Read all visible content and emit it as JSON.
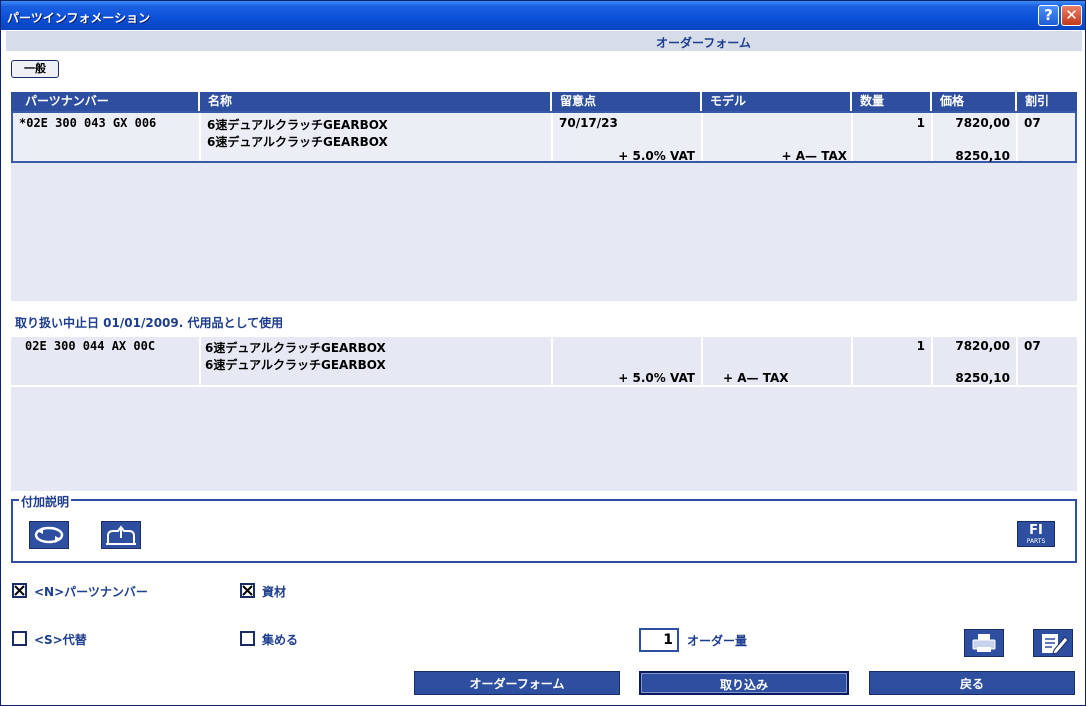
{
  "window": {
    "title": "パーツインフォメーション",
    "help_glyph": "?",
    "close_glyph": "✕"
  },
  "subheader": {
    "title": "オーダーフォーム"
  },
  "tabs": [
    {
      "label": "一般"
    }
  ],
  "table": {
    "columns": [
      "パーツナンバー",
      "名称",
      "留意点",
      "モデル",
      "数量",
      "価格",
      "割引"
    ],
    "rows": [
      {
        "part_no": "*02E 300 043 GX 006",
        "name1": "6速デュアルクラッチGEARBOX",
        "name2": "6速デュアルクラッチGEARBOX",
        "note": "70/17/23",
        "vat": "+ 5.0% VAT",
        "tax": "+  A— TAX",
        "qty": "1",
        "price": "7820,00",
        "price_tax": "8250,10",
        "discount": "07"
      }
    ]
  },
  "discontinued_note": "取り扱い中止日 01/01/2009. 代用品として使用",
  "substitute_table": {
    "rows": [
      {
        "part_no": "02E 300 044 AX 00C",
        "name1": "6速デュアルクラッチGEARBOX",
        "name2": "6速デュアルクラッチGEARBOX",
        "note": "",
        "vat": "+ 5.0% VAT",
        "tax": "+  A— TAX",
        "qty": "1",
        "price": "7820,00",
        "price_tax": "8250,10",
        "discount": "07"
      }
    ]
  },
  "additional_info": {
    "legend": "付加説明",
    "icons": [
      "refresh-icon",
      "crown-icon",
      "fi-parts-logo"
    ],
    "logo_text": "FI",
    "logo_subtext": "PARTS"
  },
  "checkboxes": [
    {
      "label": "<N>パーツナンバー",
      "checked": true
    },
    {
      "label": "資材",
      "checked": true
    },
    {
      "label": "<S>代替",
      "checked": false
    },
    {
      "label": "集める",
      "checked": false
    }
  ],
  "order_quantity": {
    "value": "1",
    "label": "オーダー量"
  },
  "buttons": {
    "order_form": "オーダーフォーム",
    "import": "取り込み",
    "back": "戻る"
  },
  "colors": {
    "accent": "#2e4fa0",
    "panel": "#e6e9f3",
    "text_blue": "#1d3d8f"
  }
}
